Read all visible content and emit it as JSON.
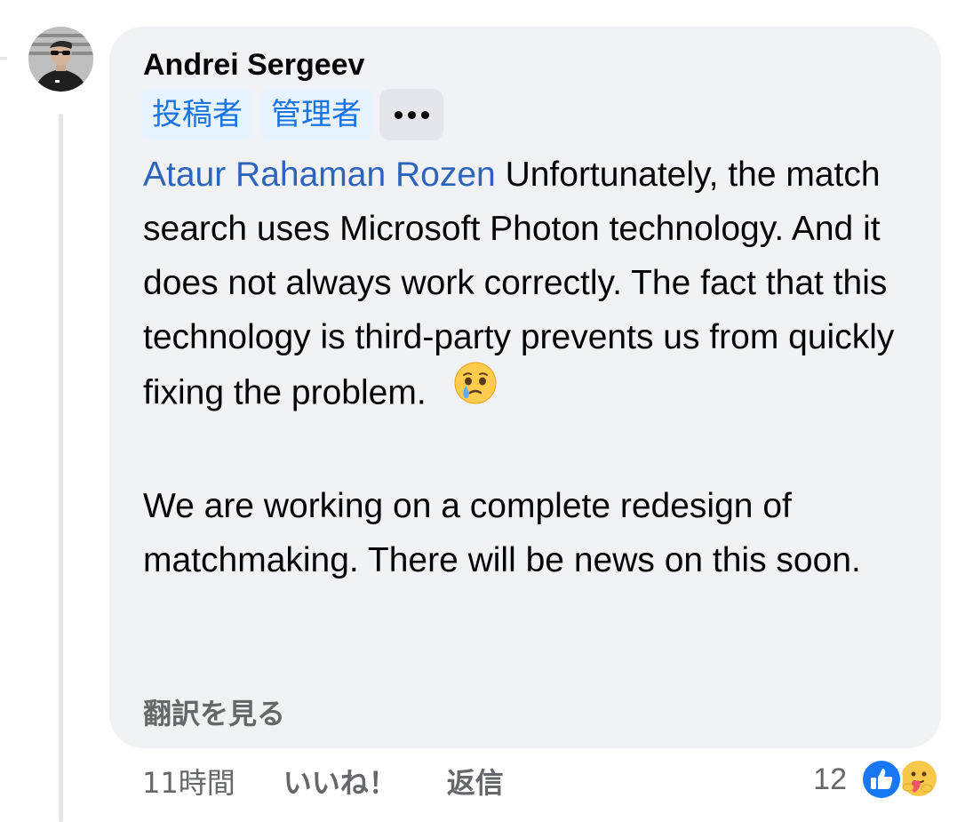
{
  "comment": {
    "author": "Andrei Sergeev",
    "badges": [
      "投稿者",
      "管理者"
    ],
    "mention": "Ataur Rahaman Rozen",
    "paragraph1": " Unfortunately, the match search uses Microsoft Photon technology. And it does not always work correctly. The fact that this technology is third-party prevents us from quickly fixing the problem.",
    "emoji": "face-holding-back-tears",
    "paragraph2": "We are working on a complete redesign of matchmaking. There will be news on this soon.",
    "see_translation": "翻訳を見る"
  },
  "actions": {
    "time": "11時間",
    "like": "いいね！",
    "reply": "返信"
  },
  "reactions": {
    "count": "12",
    "types": [
      "like-icon",
      "care-icon"
    ]
  },
  "colors": {
    "bubble": "#f0f2f5",
    "mention": "#2d64bc",
    "badge_text": "#1b74e4",
    "badge_bg": "#e7f3ff",
    "secondary_text": "#65676b",
    "like_blue": "#1877f2"
  }
}
